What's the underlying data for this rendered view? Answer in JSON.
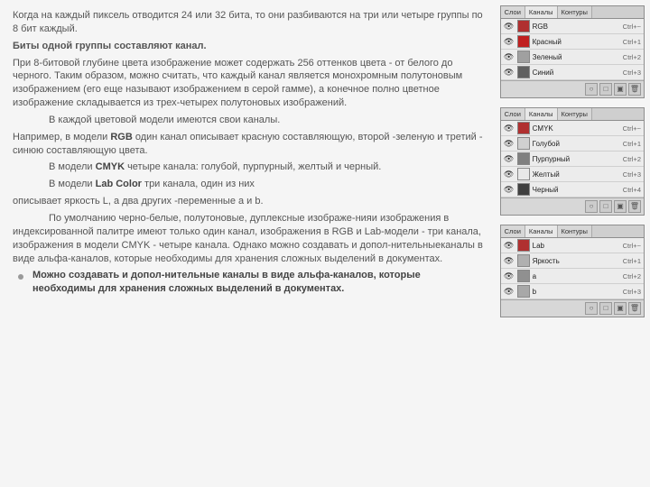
{
  "text": {
    "p1": "Когда на каждый пиксель отводится 24 или 32 бита, то они разбиваются на три или четыре группы по 8 бит каждый.",
    "p2": "Биты одной группы составляют канал.",
    "p3a": "При 8-битовой глубине цвета изображение может содержать 256 оттенков цвета - от белого до черного. Таким образом, можно считать, что каждый канал является монохромным полутоновым изображением (его еще называют изображением в серой гамме), а конечное полно цветное изображение складывается из трех-четырех полутоновых изображений.",
    "p4": "В каждой цветовой модели имеются свои каналы.",
    "p5a": "Например, в модели ",
    "p5b": "RGB",
    "p5c": " один канал описывает красную составляющую, второй -зеленую и третий - синюю составляющую цвета.",
    "p6a": "В модели ",
    "p6b": "CMYK",
    "p6c": " четыре канала: голубой, пурпурный, желтый и черный.",
    "p7a": "В модели ",
    "p7b": "Lab Color",
    "p7c": " три канала, один из них",
    "p7d": "описывает яркость L, а два других -переменные a и b.",
    "p8": "По умолчанию черно-белые, полутоновые, дуплексные изображе-нияи изображения в индексированной палитре имеют только один канал, изображения в RGB и Lab-модели - три канала, изображения в модели CMYK - четыре канала. Однако можно создавать и допол-нительныеканалы в виде альфа-каналов, которые необходимы для хранения сложных выделений в документах.",
    "bullet": "Можно создавать и допол-нительные каналы в виде альфа-каналов, которые необходимы для хранения сложных выделений в документах."
  },
  "panels": [
    {
      "tabs": [
        "Слои",
        "Каналы",
        "Контуры"
      ],
      "rows": [
        {
          "color": "#b03030",
          "label": "RGB",
          "sc": "Ctrl+~"
        },
        {
          "color": "#c02020",
          "label": "Красный",
          "sc": "Ctrl+1"
        },
        {
          "color": "#a0a0a0",
          "label": "Зеленый",
          "sc": "Ctrl+2"
        },
        {
          "color": "#606060",
          "label": "Синий",
          "sc": "Ctrl+3"
        }
      ]
    },
    {
      "tabs": [
        "Слои",
        "Каналы",
        "Контуры"
      ],
      "rows": [
        {
          "color": "#b03030",
          "label": "CMYK",
          "sc": "Ctrl+~"
        },
        {
          "color": "#d0d0d0",
          "label": "Голубой",
          "sc": "Ctrl+1"
        },
        {
          "color": "#808080",
          "label": "Пурпурный",
          "sc": "Ctrl+2"
        },
        {
          "color": "#e8e8e8",
          "label": "Желтый",
          "sc": "Ctrl+3"
        },
        {
          "color": "#404040",
          "label": "Черный",
          "sc": "Ctrl+4"
        }
      ]
    },
    {
      "tabs": [
        "Слои",
        "Каналы",
        "Контуры"
      ],
      "rows": [
        {
          "color": "#b03030",
          "label": "Lab",
          "sc": "Ctrl+~"
        },
        {
          "color": "#b0b0b0",
          "label": "Яркость",
          "sc": "Ctrl+1"
        },
        {
          "color": "#909090",
          "label": "a",
          "sc": "Ctrl+2"
        },
        {
          "color": "#a8a8a8",
          "label": "b",
          "sc": "Ctrl+3"
        }
      ]
    }
  ],
  "footer_icons": [
    "○",
    "□",
    "▣",
    "🗑"
  ]
}
